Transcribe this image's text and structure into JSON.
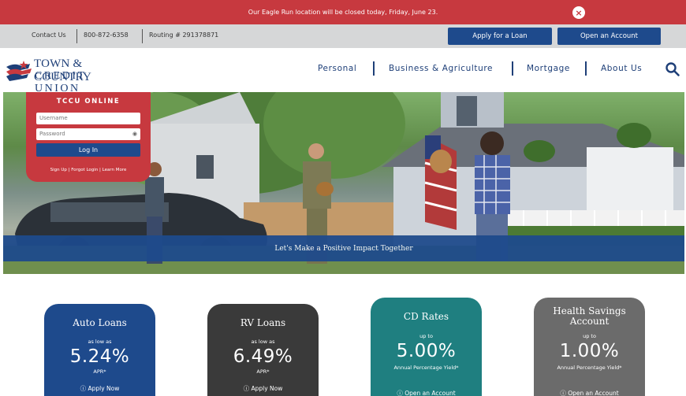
{
  "alert": {
    "message": "Our Eagle Run location will be closed today, Friday, June 23.",
    "close_icon": "×"
  },
  "utility": {
    "contact": "Contact Us",
    "phone": "800-872-6358",
    "routing": "Routing # 291378871",
    "apply_loan": "Apply for a Loan",
    "open_account": "Open an Account"
  },
  "logo": {
    "line1": "TOWN & COUNTRY",
    "line2": "CREDIT UNION"
  },
  "nav": {
    "personal": "Personal",
    "business": "Business & Agriculture",
    "mortgage": "Mortgage",
    "about": "About Us"
  },
  "login": {
    "title": "TCCU ONLINE",
    "username_placeholder": "Username",
    "password_placeholder": "Password",
    "login_button": "Log In",
    "links": "Sign Up | Forgot Login | Learn More"
  },
  "hero": {
    "tagline": "Let's Make a Positive Impact Together"
  },
  "cards": [
    {
      "title": "Auto Loans",
      "prefix": "as low as",
      "rate": "5.24%",
      "unit": "APR*",
      "action": "ⓘ Apply Now",
      "color": "#1e4a8c"
    },
    {
      "title": "RV Loans",
      "prefix": "as low as",
      "rate": "6.49%",
      "unit": "APR*",
      "action": "ⓘ Apply Now",
      "color": "#3a3a3a"
    },
    {
      "title": "CD Rates",
      "prefix": "up to",
      "rate": "5.00%",
      "unit": "Annual Percentage Yield*",
      "action": "ⓘ Open an Account",
      "color": "#1f7f80"
    },
    {
      "title": "Health Savings Account",
      "prefix": "up to",
      "rate": "1.00%",
      "unit": "Annual Percentage Yield*",
      "action": "ⓘ Open an Account",
      "color": "#6b6b6b"
    }
  ],
  "colors": {
    "brand_red": "#c7393f",
    "brand_blue": "#1e4a8c",
    "nav_blue": "#1e3f78"
  }
}
